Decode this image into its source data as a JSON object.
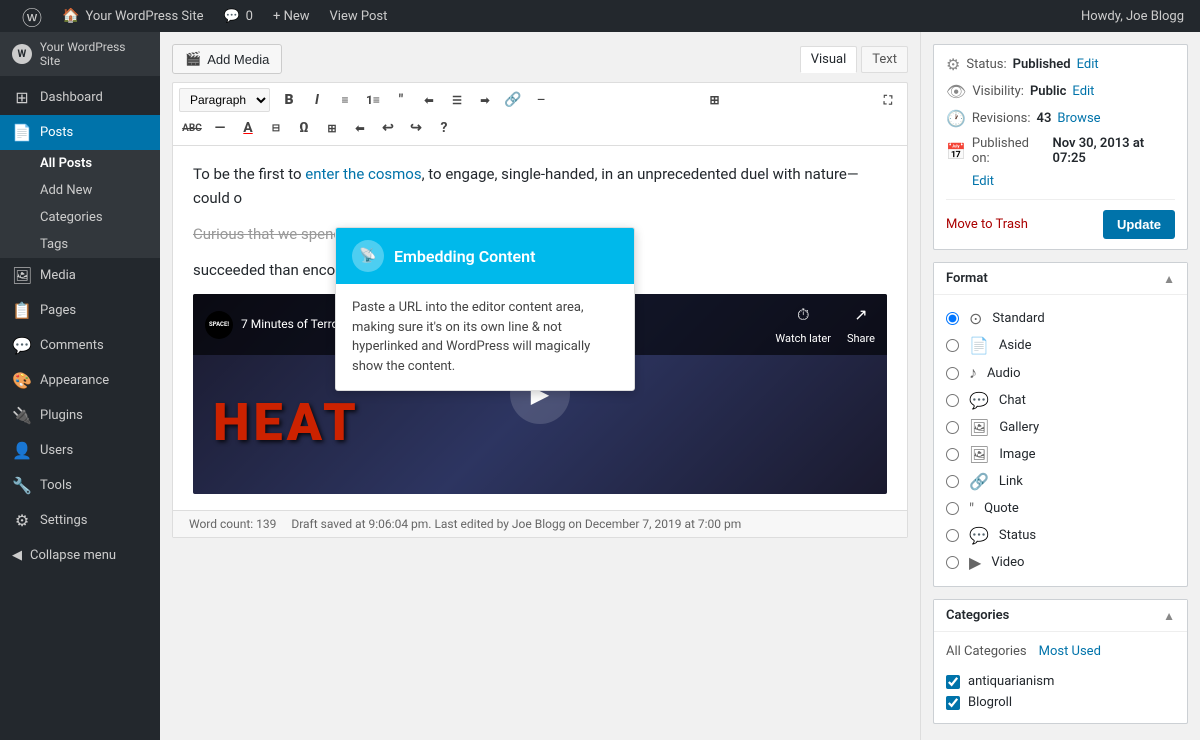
{
  "adminbar": {
    "wp_icon": "⓵",
    "site_name": "Your WordPress Site",
    "comments_icon": "💬",
    "comments_count": "0",
    "new_label": "+ New",
    "view_post": "View Post",
    "howdy": "Howdy, Joe Blogg"
  },
  "sidebar": {
    "site_name": "Your WordPress Site",
    "items": [
      {
        "id": "dashboard",
        "icon": "⊞",
        "label": "Dashboard"
      },
      {
        "id": "posts",
        "icon": "📄",
        "label": "Posts",
        "active": true
      },
      {
        "id": "media",
        "icon": "🖼",
        "label": "Media"
      },
      {
        "id": "pages",
        "icon": "📋",
        "label": "Pages"
      },
      {
        "id": "comments",
        "icon": "💬",
        "label": "Comments"
      },
      {
        "id": "appearance",
        "icon": "🎨",
        "label": "Appearance"
      },
      {
        "id": "plugins",
        "icon": "🔌",
        "label": "Plugins"
      },
      {
        "id": "users",
        "icon": "👤",
        "label": "Users"
      },
      {
        "id": "tools",
        "icon": "🔧",
        "label": "Tools"
      },
      {
        "id": "settings",
        "icon": "⚙",
        "label": "Settings"
      }
    ],
    "submenu": {
      "parent": "posts",
      "items": [
        {
          "id": "all-posts",
          "label": "All Posts",
          "active": true
        },
        {
          "id": "add-new",
          "label": "Add New"
        },
        {
          "id": "categories",
          "label": "Categories"
        },
        {
          "id": "tags",
          "label": "Tags"
        }
      ]
    },
    "collapse": "Collapse menu"
  },
  "editor": {
    "add_media": "Add Media",
    "visual_tab": "Visual",
    "text_tab": "Text",
    "format_select": "Paragraph",
    "toolbar_buttons": [
      "B",
      "I",
      "≡",
      "≡",
      "❝",
      "⬅",
      "☰",
      "⬅",
      "🔗",
      "☰",
      "⊞"
    ],
    "toolbar_row2": [
      "ABC",
      "—",
      "A",
      "⊟",
      "∞",
      "Σ",
      "⊞",
      "⬅",
      "↩",
      "↪",
      "?"
    ],
    "content_p1_before": "To be the first to ",
    "content_link": "enter the cosmos",
    "content_p1_after": ", to engage, single-handed, in an unprecedented duel with nature—could o",
    "content_p2": "Curious that we spend more time congratu",
    "content_p3": "succeeded than encouraging people who h",
    "video_channel": "SPACE!",
    "video_title": "7 Minutes of Terror: Curiosity Rover's Risky Mars L...",
    "video_watch_later": "Watch later",
    "video_share": "Share",
    "video_heat_text": "HEAT",
    "word_count_label": "Word count: 139",
    "draft_saved": "Draft saved at 9:06:04 pm. Last edited by Joe Blogg on December 7, 2019 at 7:00 pm"
  },
  "tooltip": {
    "title": "Embedding Content",
    "icon": "📡",
    "body": "Paste a URL into the editor content area, making sure it's on its own line & not hyperlinked and WordPress will magically show the content."
  },
  "publish_box": {
    "status_label": "Status:",
    "status_value": "Published",
    "status_link": "Edit",
    "visibility_label": "Visibility:",
    "visibility_value": "Public",
    "visibility_link": "Edit",
    "revisions_label": "Revisions:",
    "revisions_value": "43",
    "revisions_link": "Browse",
    "published_label": "Published on:",
    "published_value": "Nov 30, 2013 at 07:25",
    "published_link": "Edit",
    "move_to_trash": "Move to Trash",
    "update": "Update"
  },
  "format_box": {
    "title": "Format",
    "options": [
      {
        "id": "standard",
        "icon": "⊙",
        "label": "Standard",
        "checked": true
      },
      {
        "id": "aside",
        "icon": "📄",
        "label": "Aside",
        "checked": false
      },
      {
        "id": "audio",
        "icon": "♪",
        "label": "Audio",
        "checked": false
      },
      {
        "id": "chat",
        "icon": "💬",
        "label": "Chat",
        "checked": false
      },
      {
        "id": "gallery",
        "icon": "🖼",
        "label": "Gallery",
        "checked": false
      },
      {
        "id": "image",
        "icon": "🖼",
        "label": "Image",
        "checked": false
      },
      {
        "id": "link",
        "icon": "🔗",
        "label": "Link",
        "checked": false
      },
      {
        "id": "quote",
        "icon": "❝",
        "label": "Quote",
        "checked": false
      },
      {
        "id": "status",
        "icon": "💬",
        "label": "Status",
        "checked": false
      },
      {
        "id": "video",
        "icon": "▶",
        "label": "Video",
        "checked": false
      }
    ]
  },
  "categories_box": {
    "title": "Categories",
    "tab_all": "All Categories",
    "tab_most_used": "Most Used",
    "items": [
      {
        "label": "antiquarianism",
        "checked": true
      },
      {
        "label": "Blogroll",
        "checked": true
      }
    ]
  }
}
